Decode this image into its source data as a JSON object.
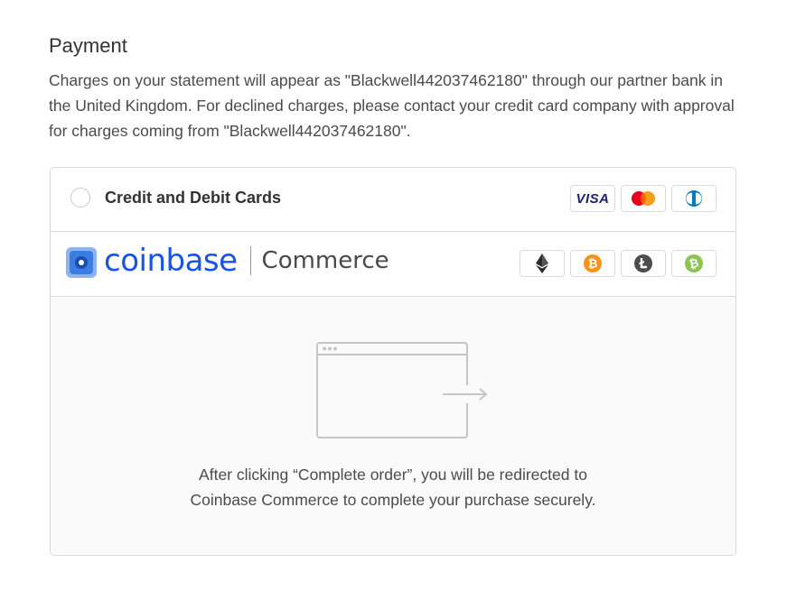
{
  "section": {
    "title": "Payment",
    "description": "Charges on your statement will appear as \"Blackwell442037462180\" through our partner bank in the United Kingdom. For declined charges, please contact your credit card company with approval for charges coming from \"Blackwell442037462180\"."
  },
  "payment_methods": {
    "cards": {
      "label": "Credit and Debit Cards",
      "selected": false,
      "badges": [
        "visa-icon",
        "mastercard-icon",
        "diners-club-icon"
      ],
      "visa_text": "VISA"
    },
    "coinbase": {
      "brand": "coinbase",
      "brand_suffix": "Commerce",
      "selected": true,
      "badges": [
        "ethereum-icon",
        "bitcoin-icon",
        "litecoin-icon",
        "bitcoin-cash-icon"
      ]
    }
  },
  "redirect_info": {
    "illustration": "browser-redirect-icon",
    "line1": "After clicking “Complete order”, you will be redirected to",
    "line2": "Coinbase Commerce to complete your purchase securely."
  },
  "colors": {
    "coinbase_blue": "#1652f0",
    "selected_radio": "#3b7de0",
    "bitcoin": "#f7931a",
    "litecoin": "#4d4d4d",
    "bitcoin_cash": "#8dc351"
  }
}
